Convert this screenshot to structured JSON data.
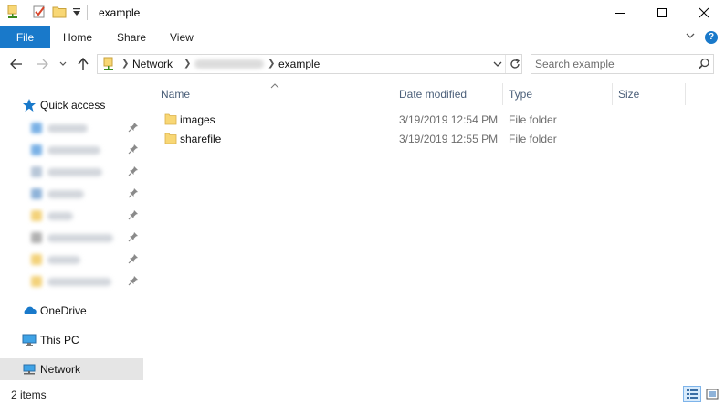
{
  "window": {
    "title": "example"
  },
  "ribbon": {
    "tabs": [
      {
        "label": "File"
      },
      {
        "label": "Home"
      },
      {
        "label": "Share"
      },
      {
        "label": "View"
      }
    ]
  },
  "address": {
    "crumbs": [
      "Network",
      "example"
    ]
  },
  "search": {
    "placeholder": "Search example"
  },
  "sidebar": {
    "quick_access_label": "Quick access",
    "onedrive_label": "OneDrive",
    "thispc_label": "This PC",
    "network_label": "Network"
  },
  "columns": {
    "name": "Name",
    "date_modified": "Date modified",
    "type": "Type",
    "size": "Size"
  },
  "files": [
    {
      "name": "images",
      "date": "3/19/2019 12:54 PM",
      "type": "File folder"
    },
    {
      "name": "sharefile",
      "date": "3/19/2019 12:55 PM",
      "type": "File folder"
    }
  ],
  "status": {
    "items_text": "2 items"
  },
  "colors": {
    "accent": "#1979ca",
    "folder": "#f8d775",
    "selected": "#e5e5e5"
  }
}
